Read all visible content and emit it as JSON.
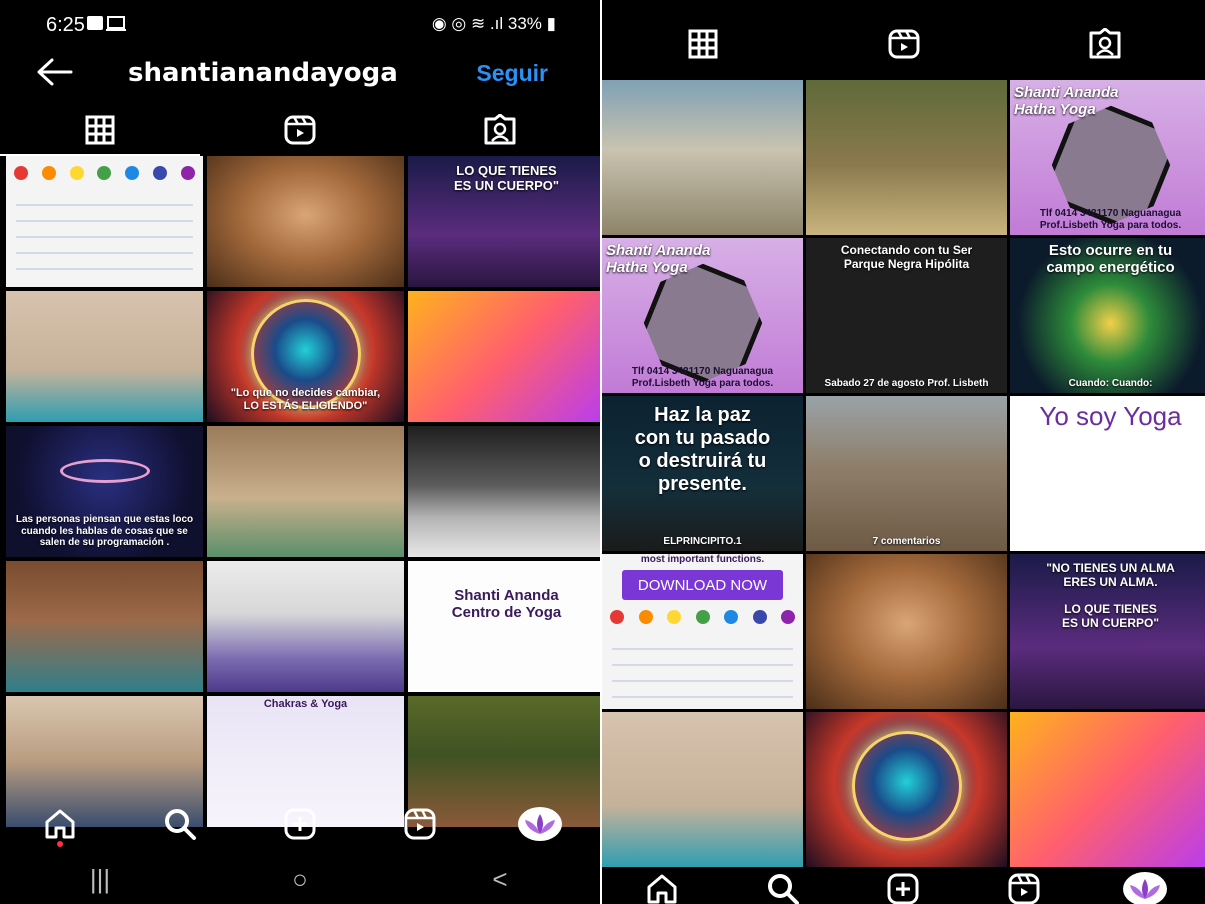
{
  "status_bar": {
    "time": "6:25",
    "battery": "33%"
  },
  "profile": {
    "username": "shantianandayoga",
    "follow_label": "Seguir"
  },
  "tabs": {
    "left": [
      {
        "icon": "grid-icon",
        "active": true
      },
      {
        "icon": "reels-icon",
        "active": false
      },
      {
        "icon": "tagged-icon",
        "active": false
      }
    ],
    "right": [
      {
        "icon": "grid-icon",
        "active": true
      },
      {
        "icon": "reels-icon",
        "active": false
      },
      {
        "icon": "tagged-icon",
        "active": false
      }
    ]
  },
  "left_posts": [
    {
      "name": "yoga-poses-chart-post",
      "bg": "bg-chart",
      "caption": ""
    },
    {
      "name": "face-portrait-post",
      "bg": "bg-face",
      "caption": ""
    },
    {
      "name": "lo-que-tienes-post",
      "bg": "bg-space",
      "caption": "LO QUE TIENES\nES UN CUERPO\""
    },
    {
      "name": "headstand-post",
      "bg": "bg-room1",
      "caption": ""
    },
    {
      "name": "cosmic-quote-post",
      "bg": "bg-cosmic",
      "caption": "\"Lo que no decides cambiar,\nLO ESTÁS ELIGIENDO\""
    },
    {
      "name": "collage-post",
      "bg": "bg-collage",
      "caption": ""
    },
    {
      "name": "stars-quote-post",
      "bg": "bg-stars",
      "caption": "Las personas piensan que estas loco cuando les hablas de cosas que se salen de su programación ."
    },
    {
      "name": "downward-dog-post",
      "bg": "bg-room2",
      "caption": ""
    },
    {
      "name": "class-floor-post",
      "bg": "bg-room3",
      "caption": ""
    },
    {
      "name": "pose-room-post",
      "bg": "bg-room4",
      "caption": ""
    },
    {
      "name": "group-class-post",
      "bg": "bg-class",
      "caption": ""
    },
    {
      "name": "centro-de-yoga-post",
      "bg": "bg-white",
      "caption": "Shanti Ananda\nCentro de Yoga"
    },
    {
      "name": "partner-yoga-post",
      "bg": "bg-class2",
      "caption": ""
    },
    {
      "name": "chakras-yoga-post",
      "bg": "bg-chakras",
      "caption": "Chakras & Yoga"
    },
    {
      "name": "park-class-post",
      "bg": "bg-park",
      "caption": ""
    }
  ],
  "right_posts": [
    {
      "name": "beach-class-post",
      "bg": "bg-beach",
      "caption": ""
    },
    {
      "name": "meditation-post",
      "bg": "bg-jungle",
      "caption": ""
    },
    {
      "name": "hatha-yoga-post-1",
      "bg": "bg-purple",
      "caption": "Shanti Ananda\nHatha Yoga",
      "footer": "Tlf 0414 3421170   Naguanagua\nProf.Lisbeth  Yoga para todos."
    },
    {
      "name": "hatha-yoga-post-2",
      "bg": "bg-purple",
      "caption": "Shanti Ananda\nHatha Yoga",
      "footer": "Tlf 0414 3421170   Naguanagua\nProf.Lisbeth  Yoga para todos."
    },
    {
      "name": "parque-negra-hipolita-post",
      "bg": "bg-poster",
      "caption": "Conectando con tu Ser\nParque Negra Hipólita",
      "footer": "Sabado 27 de agosto   Prof. Lisbeth"
    },
    {
      "name": "campo-energetico-post",
      "bg": "bg-field",
      "caption": "Esto ocurre en tu\ncampo energético",
      "footer": "Cuando:       Cuando:"
    },
    {
      "name": "haz-la-paz-post",
      "bg": "bg-night",
      "caption": "Haz la paz\ncon tu pasado\no destruirá tu presente.",
      "footer": "ELPRINCIPITO.1"
    },
    {
      "name": "temple-post",
      "bg": "bg-temple",
      "caption": "",
      "footer": "7 comentarios"
    },
    {
      "name": "yo-soy-yoga-post",
      "bg": "bg-yogagirl",
      "caption": "Yo soy Yoga"
    },
    {
      "name": "download-chart-post",
      "bg": "bg-chart",
      "caption": "most important functions.",
      "button": "DOWNLOAD NOW"
    },
    {
      "name": "face-portrait-post-2",
      "bg": "bg-face",
      "caption": ""
    },
    {
      "name": "eres-un-alma-post",
      "bg": "bg-space",
      "caption": "\"NO TIENES UN ALMA\nERES UN ALMA.\n\nLO QUE TIENES\nES UN CUERPO\""
    },
    {
      "name": "headstand-post-2",
      "bg": "bg-room1",
      "caption": ""
    },
    {
      "name": "cosmic-post-2",
      "bg": "bg-cosmic",
      "caption": ""
    },
    {
      "name": "collage-post-2",
      "bg": "bg-collage",
      "caption": ""
    }
  ],
  "bottom_nav": [
    "home-icon",
    "search-icon",
    "create-icon",
    "reels-icon",
    "profile-avatar"
  ],
  "android_nav": {
    "recents": "|||",
    "home": "○",
    "back": "<"
  }
}
